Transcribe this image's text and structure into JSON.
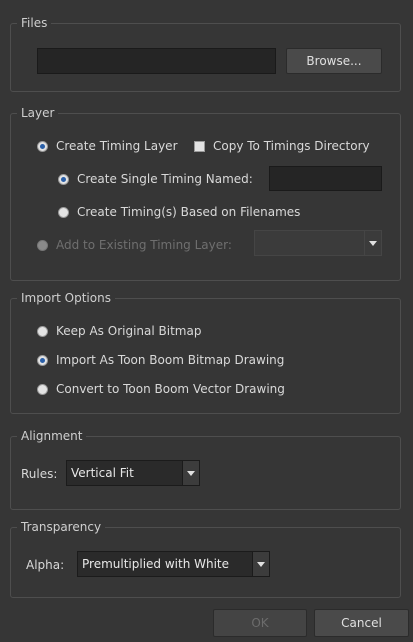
{
  "files": {
    "title": "Files",
    "path_value": "",
    "browse_label": "Browse..."
  },
  "layer": {
    "title": "Layer",
    "create_timing_layer": "Create Timing Layer",
    "copy_to_timings": "Copy To Timings Directory",
    "create_single_timing": "Create Single Timing Named:",
    "timing_name_value": "",
    "create_timings_filenames": "Create Timing(s) Based on Filenames",
    "add_existing_timing": "Add to Existing Timing Layer:",
    "existing_timing_value": ""
  },
  "import_options": {
    "title": "Import Options",
    "keep_original": "Keep As Original Bitmap",
    "import_toon_boom_bitmap": "Import As Toon Boom Bitmap Drawing",
    "convert_vector": "Convert to Toon Boom Vector Drawing"
  },
  "alignment": {
    "title": "Alignment",
    "rules_label": "Rules:",
    "rules_value": "Vertical Fit"
  },
  "transparency": {
    "title": "Transparency",
    "alpha_label": "Alpha:",
    "alpha_value": "Premultiplied with White"
  },
  "footer": {
    "ok_label": "OK",
    "cancel_label": "Cancel"
  }
}
